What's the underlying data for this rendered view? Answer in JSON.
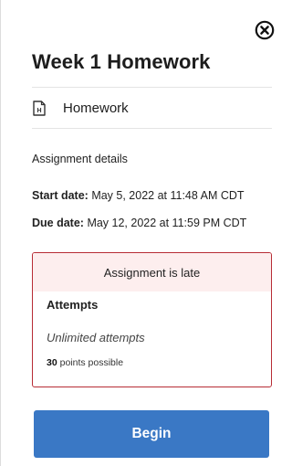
{
  "panel": {
    "title": "Week 1 Homework",
    "close_icon": "circle-x-icon",
    "type": {
      "icon": "homework-document-icon",
      "icon_letter": "H",
      "label": "Homework"
    }
  },
  "details": {
    "heading": "Assignment details",
    "start_label": "Start date:",
    "start_value": "May 5, 2022 at 11:48 AM CDT",
    "due_label": "Due date:",
    "due_value": "May 12, 2022 at 11:59 PM CDT"
  },
  "status": {
    "banner": "Assignment is late",
    "attempts_heading": "Attempts",
    "attempts_value": "Unlimited attempts",
    "points": "30",
    "points_suffix": "points possible"
  },
  "actions": {
    "begin_label": "Begin"
  },
  "colors": {
    "accent_button": "#3a78c5",
    "late_border": "#b72c35",
    "late_background": "#fdeeee"
  }
}
